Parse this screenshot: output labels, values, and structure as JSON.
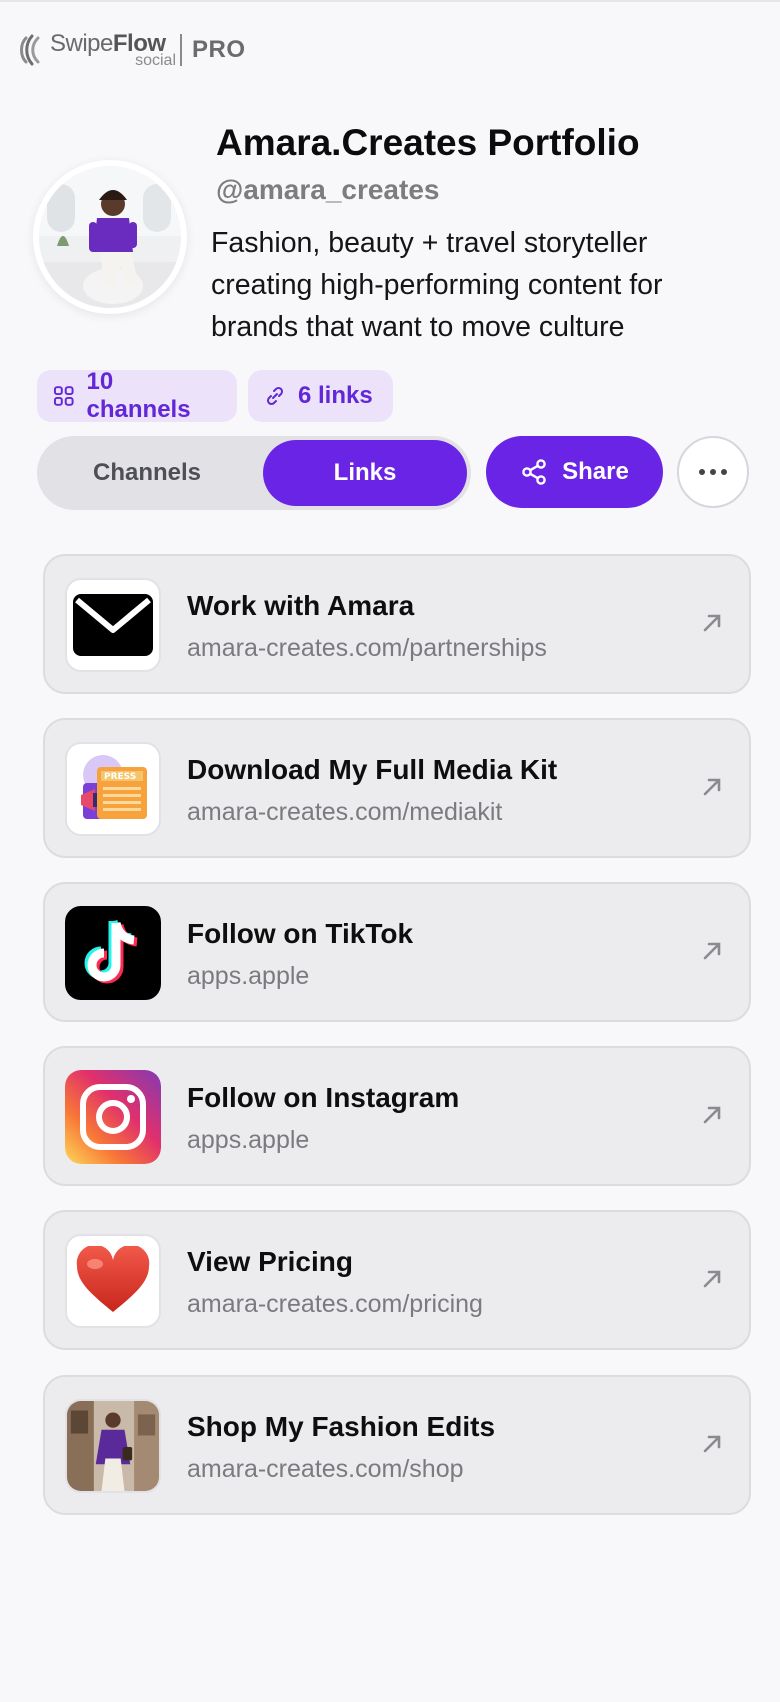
{
  "brand": {
    "name_light": "Swipe",
    "name_bold": "Flow",
    "sub": "social",
    "tier": "PRO"
  },
  "profile": {
    "title": "Amara.Creates Portfolio",
    "handle": "@amara_creates",
    "bio": "Fashion, beauty + travel storyteller creating high-performing content for brands that want to move culture",
    "avatar_icon": "profile-photo"
  },
  "stats": {
    "channels_label": "10 channels",
    "links_label": "6 links"
  },
  "tabs": {
    "channels": "Channels",
    "links": "Links",
    "active": "Links"
  },
  "actions": {
    "share": "Share",
    "more_icon": "more-dots-icon"
  },
  "links": [
    {
      "title": "Work with Amara",
      "url": "amara-creates.com/partnerships",
      "icon": "mail-icon"
    },
    {
      "title": "Download My Full Media Kit",
      "url": "amara-creates.com/mediakit",
      "icon": "press-kit-icon"
    },
    {
      "title": "Follow on TikTok",
      "url": "apps.apple",
      "icon": "tiktok-icon"
    },
    {
      "title": "Follow on Instagram",
      "url": "apps.apple",
      "icon": "instagram-icon"
    },
    {
      "title": "View Pricing",
      "url": "amara-creates.com/pricing",
      "icon": "heart-icon"
    },
    {
      "title": "Shop My Fashion Edits",
      "url": "amara-creates.com/shop",
      "icon": "fashion-photo"
    }
  ],
  "colors": {
    "accent": "#6a24e6",
    "pill_bg": "#ece3fb",
    "pill_text": "#6228d7",
    "card_bg": "#ececee",
    "page_bg": "#f8f8fa"
  }
}
